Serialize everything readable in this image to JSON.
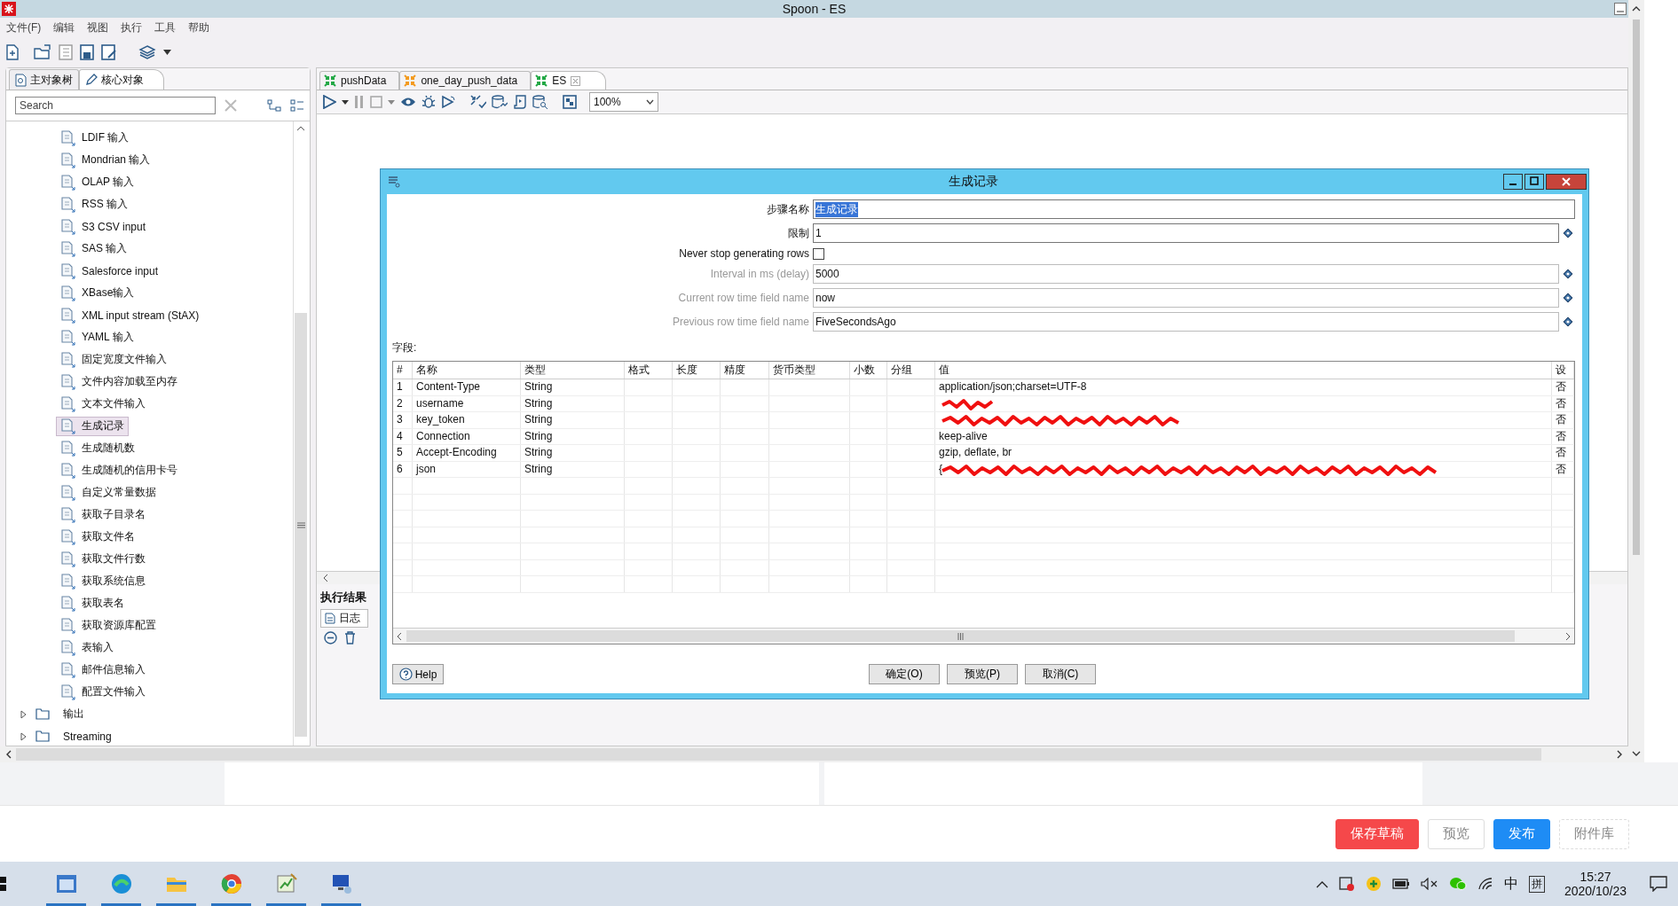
{
  "window": {
    "title": "Spoon - ES"
  },
  "menu": [
    "文件(F)",
    "编辑",
    "视图",
    "执行",
    "工具",
    "帮助"
  ],
  "left_panel": {
    "tabs": [
      {
        "label": "主对象树",
        "selected": false
      },
      {
        "label": "核心对象",
        "selected": true
      }
    ],
    "search": {
      "placeholder": "Search"
    },
    "tree": [
      {
        "label": "LDIF 输入",
        "kind": "step",
        "selected": false
      },
      {
        "label": "Mondrian 输入",
        "kind": "step",
        "selected": false
      },
      {
        "label": "OLAP 输入",
        "kind": "step",
        "selected": false
      },
      {
        "label": "RSS 输入",
        "kind": "step",
        "selected": false
      },
      {
        "label": "S3 CSV input",
        "kind": "step",
        "selected": false
      },
      {
        "label": "SAS 输入",
        "kind": "step",
        "selected": false
      },
      {
        "label": "Salesforce input",
        "kind": "step",
        "selected": false
      },
      {
        "label": "XBase输入",
        "kind": "step",
        "selected": false
      },
      {
        "label": "XML input stream (StAX)",
        "kind": "step",
        "selected": false
      },
      {
        "label": "YAML 输入",
        "kind": "step",
        "selected": false
      },
      {
        "label": "固定宽度文件输入",
        "kind": "step",
        "selected": false
      },
      {
        "label": "文件内容加载至内存",
        "kind": "step",
        "selected": false
      },
      {
        "label": "文本文件输入",
        "kind": "step",
        "selected": false
      },
      {
        "label": "生成记录",
        "kind": "step",
        "selected": true
      },
      {
        "label": "生成随机数",
        "kind": "step",
        "selected": false
      },
      {
        "label": "生成随机的信用卡号",
        "kind": "step",
        "selected": false
      },
      {
        "label": "自定义常量数据",
        "kind": "step",
        "selected": false
      },
      {
        "label": "获取子目录名",
        "kind": "step",
        "selected": false
      },
      {
        "label": "获取文件名",
        "kind": "step",
        "selected": false
      },
      {
        "label": "获取文件行数",
        "kind": "step",
        "selected": false
      },
      {
        "label": "获取系统信息",
        "kind": "step",
        "selected": false
      },
      {
        "label": "获取表名",
        "kind": "step",
        "selected": false
      },
      {
        "label": "获取资源库配置",
        "kind": "step",
        "selected": false
      },
      {
        "label": "表输入",
        "kind": "step",
        "selected": false
      },
      {
        "label": "邮件信息输入",
        "kind": "step",
        "selected": false
      },
      {
        "label": "配置文件输入",
        "kind": "step",
        "selected": false
      },
      {
        "label": "输出",
        "kind": "folder",
        "selected": false
      },
      {
        "label": "Streaming",
        "kind": "folder",
        "selected": false
      }
    ]
  },
  "editor_tabs": [
    {
      "label": "pushData",
      "selected": false,
      "closable": false,
      "color": "#22a845"
    },
    {
      "label": "one_day_push_data",
      "selected": false,
      "closable": false,
      "color": "#f39a1e"
    },
    {
      "label": "ES",
      "selected": true,
      "closable": true,
      "color": "#22a845"
    }
  ],
  "zoom": "100%",
  "results_panel": {
    "title": "执行结果",
    "tabs": [
      {
        "label": "日志",
        "selected": true
      }
    ]
  },
  "dialog": {
    "title": "生成记录",
    "form": [
      {
        "label": "步骤名称",
        "kind": "text",
        "value": "生成记录",
        "value_selected": true,
        "disabled": false,
        "variable": false
      },
      {
        "label": "限制",
        "kind": "text",
        "value": "1",
        "value_selected": false,
        "disabled": false,
        "variable": true
      },
      {
        "label": "Never stop generating rows",
        "kind": "checkbox",
        "checked": false
      },
      {
        "label": "Interval in ms (delay)",
        "kind": "text",
        "value": "5000",
        "value_selected": false,
        "disabled": true,
        "variable": true
      },
      {
        "label": "Current row time field name",
        "kind": "text",
        "value": "now",
        "value_selected": false,
        "disabled": true,
        "variable": true
      },
      {
        "label": "Previous row time field name",
        "kind": "text",
        "value": "FiveSecondsAgo",
        "value_selected": false,
        "disabled": true,
        "variable": true
      }
    ],
    "fields_label": "字段:",
    "table": {
      "columns": [
        "#",
        "名称",
        "类型",
        "格式",
        "长度",
        "精度",
        "货币类型",
        "小数",
        "分组",
        "值",
        "设"
      ],
      "rows": [
        {
          "num": "1",
          "name": "Content-Type",
          "type": "String",
          "value": "application/json;charset=UTF-8",
          "column_11": "否",
          "redacted": false
        },
        {
          "num": "2",
          "name": "username",
          "type": "String",
          "column_11": "否",
          "redacted": true
        },
        {
          "num": "3",
          "name": "key_token",
          "type": "String",
          "column_11": "否",
          "redacted": true
        },
        {
          "num": "4",
          "name": "Connection",
          "type": "String",
          "value": "keep-alive",
          "column_11": "否",
          "redacted": false
        },
        {
          "num": "5",
          "name": "Accept-Encoding",
          "type": "String",
          "value": "gzip, deflate, br",
          "column_11": "否",
          "redacted": false
        },
        {
          "num": "6",
          "name": "json",
          "type": "String",
          "value": "{",
          "column_11": "否",
          "redacted": true
        }
      ]
    },
    "buttons": [
      {
        "label": "Help",
        "kind": "help"
      },
      {
        "label": "确定(O)",
        "kind": "action"
      },
      {
        "label": "预览(P)",
        "kind": "action"
      },
      {
        "label": "取消(C)",
        "kind": "action"
      }
    ]
  },
  "page_buttons": [
    {
      "label": "保存草稿",
      "kind": "danger"
    },
    {
      "label": "预览",
      "kind": "plain"
    },
    {
      "label": "发布",
      "kind": "primary"
    },
    {
      "label": "附件库",
      "kind": "dashed"
    }
  ],
  "taskbar": {
    "ime": [
      "中",
      "拼"
    ],
    "time": "15:27",
    "date": "2020/10/23"
  }
}
